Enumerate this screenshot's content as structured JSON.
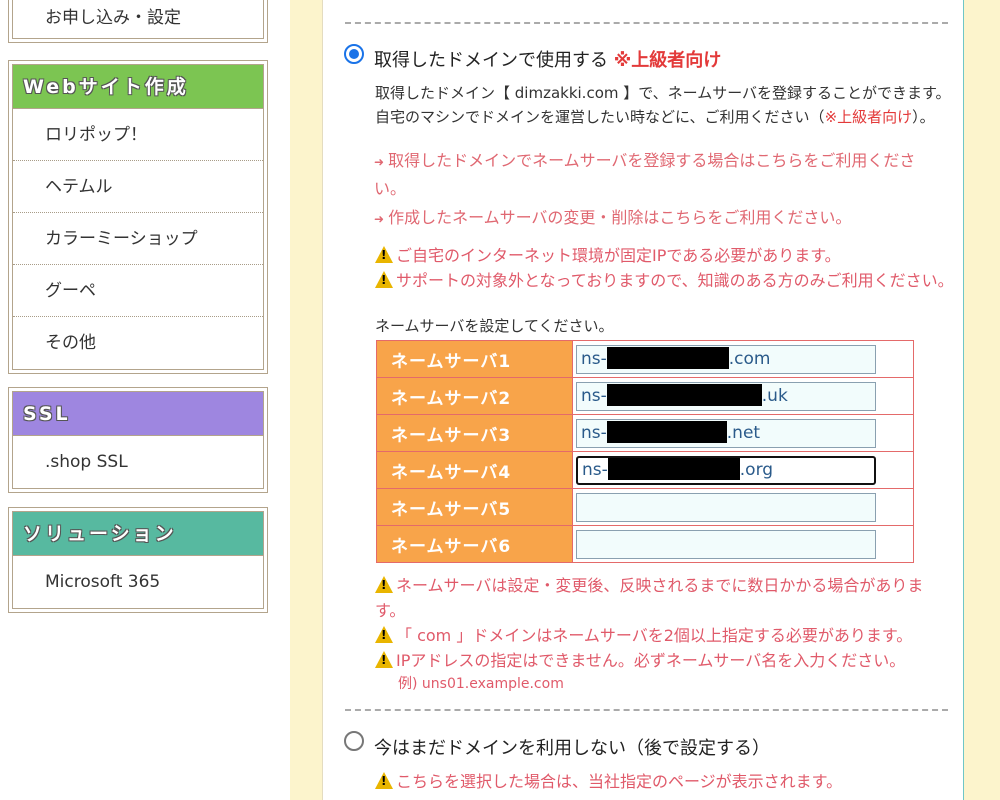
{
  "sidebar": {
    "top_box": {
      "item": "お申し込み・設定"
    },
    "boxes": [
      {
        "header": "Webサイト作成",
        "color": "#7cc552",
        "items": [
          "ロリポップ！",
          "ヘテムル",
          "カラーミーショップ",
          "グーペ",
          "その他"
        ]
      },
      {
        "header": "SSL",
        "color": "#9e86e0",
        "items": [
          ".shop SSL"
        ]
      },
      {
        "header": "ソリューション",
        "color": "#57b9a0",
        "items": [
          "Microsoft 365"
        ]
      }
    ]
  },
  "option_owned": {
    "title": "取得したドメインで使用する",
    "badge": "※上級者向け",
    "desc1_a": "取得したドメイン【 dimzakki.com 】で、ネームサーバを登録することができます。",
    "desc2_a": "自宅のマシンでドメインを運営したい時などに、ご利用ください（",
    "desc2_b": "※上級者向け",
    "desc2_c": "）。",
    "link1_a": "取得したドメインでネームサーバを登録する場合はこちらをご利用くださ",
    "link1_b": "い。",
    "link2": "作成したネームサーバの変更・削除はこちらをご利用ください。",
    "warn1": "ご自宅のインターネット環境が固定IPである必要があります。",
    "warn2": "サポートの対象外となっておりますので、知識のある方のみご利用ください。",
    "ns_prompt": "ネームサーバを設定してください。",
    "nameservers": [
      {
        "label": "ネームサーバ1",
        "prefix": "ns-",
        "suffix": ".com"
      },
      {
        "label": "ネームサーバ2",
        "prefix": "ns-",
        "suffix": ".uk"
      },
      {
        "label": "ネームサーバ3",
        "prefix": "ns-",
        "suffix": ".net"
      },
      {
        "label": "ネームサーバ4",
        "prefix": "ns-",
        "suffix": ".org"
      },
      {
        "label": "ネームサーバ5",
        "prefix": "",
        "suffix": ""
      },
      {
        "label": "ネームサーバ6",
        "prefix": "",
        "suffix": ""
      }
    ],
    "note1_a": "ネームサーバは設定・変更後、反映されるまでに数日かかる場合がありま",
    "note1_b": "す。",
    "note2": "「 com 」ドメインはネームサーバを2個以上指定する必要があります。",
    "note3": "IPアドレスの指定はできません。必ずネームサーバ名を入力ください。",
    "example": "例) uns01.example.com"
  },
  "option_later": {
    "title": "今はまだドメインを利用しない（後で設定する）",
    "warn1": "こちらを選択した場合は、当社指定のページが表示されます。"
  }
}
